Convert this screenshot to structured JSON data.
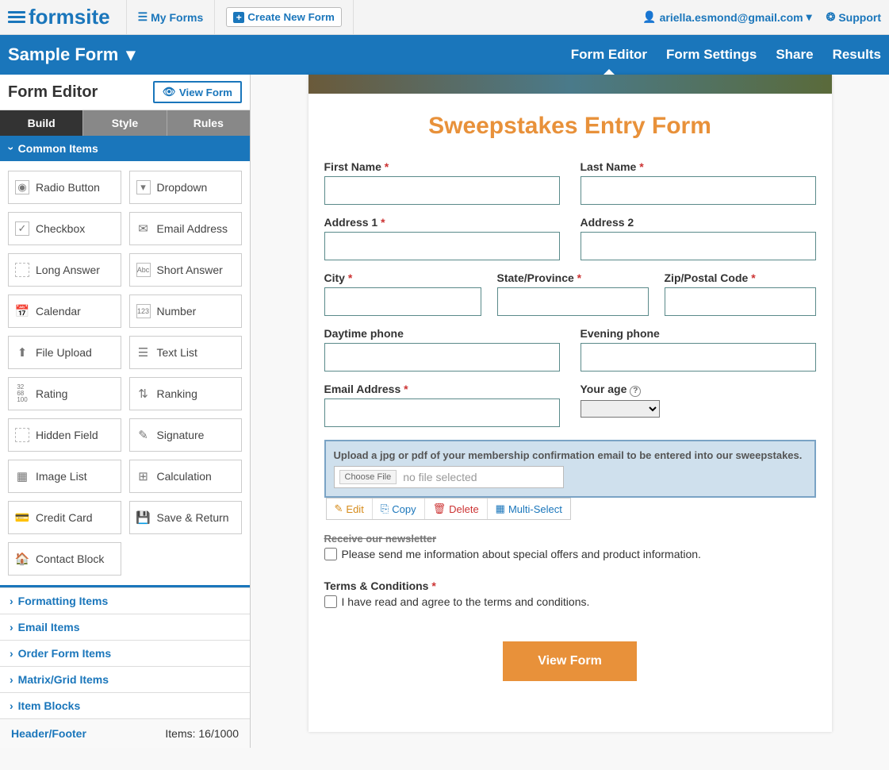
{
  "top": {
    "brand": "formsite",
    "my_forms": "My Forms",
    "create": "Create New Form",
    "user": "ariella.esmond@gmail.com",
    "support": "Support"
  },
  "blue": {
    "form_name": "Sample Form",
    "tabs": {
      "editor": "Form Editor",
      "settings": "Form Settings",
      "share": "Share",
      "results": "Results"
    }
  },
  "sidebar": {
    "title": "Form Editor",
    "view_form": "View Form",
    "seg": {
      "build": "Build",
      "style": "Style",
      "rules": "Rules"
    },
    "sections": {
      "common": "Common Items",
      "formatting": "Formatting Items",
      "email": "Email Items",
      "order": "Order Form Items",
      "matrix": "Matrix/Grid Items",
      "blocks": "Item Blocks"
    },
    "items": {
      "radio": "Radio Button",
      "dropdown": "Dropdown",
      "checkbox": "Checkbox",
      "email": "Email Address",
      "long": "Long Answer",
      "short": "Short Answer",
      "calendar": "Calendar",
      "number": "Number",
      "upload": "File Upload",
      "textlist": "Text List",
      "rating": "Rating",
      "ranking": "Ranking",
      "hidden": "Hidden Field",
      "signature": "Signature",
      "imagelist": "Image List",
      "calc": "Calculation",
      "cc": "Credit Card",
      "save": "Save & Return",
      "contact": "Contact Block"
    },
    "footer": {
      "left": "Header/Footer",
      "right": "Items: 16/1000"
    }
  },
  "form": {
    "title": "Sweepstakes Entry Form",
    "labels": {
      "first": "First Name",
      "last": "Last Name",
      "addr1": "Address 1",
      "addr2": "Address 2",
      "city": "City",
      "state": "State/Province",
      "zip": "Zip/Postal Code",
      "dayphone": "Daytime phone",
      "evephone": "Evening phone",
      "email": "Email Address",
      "age": "Your age"
    },
    "upload_text": "Upload a jpg or pdf of your membership confirmation email to be entered into our sweepstakes.",
    "choose_file": "Choose File",
    "no_file": "no file selected",
    "actions": {
      "edit": "Edit",
      "copy": "Copy",
      "delete": "Delete",
      "multi": "Multi-Select"
    },
    "newsletter_hdr": "Receive our newsletter",
    "newsletter_cb": "Please send me information about special offers and product information.",
    "terms_hdr": "Terms & Conditions",
    "terms_cb": "I have read and agree to the terms and conditions.",
    "view_form_btn": "View Form"
  }
}
